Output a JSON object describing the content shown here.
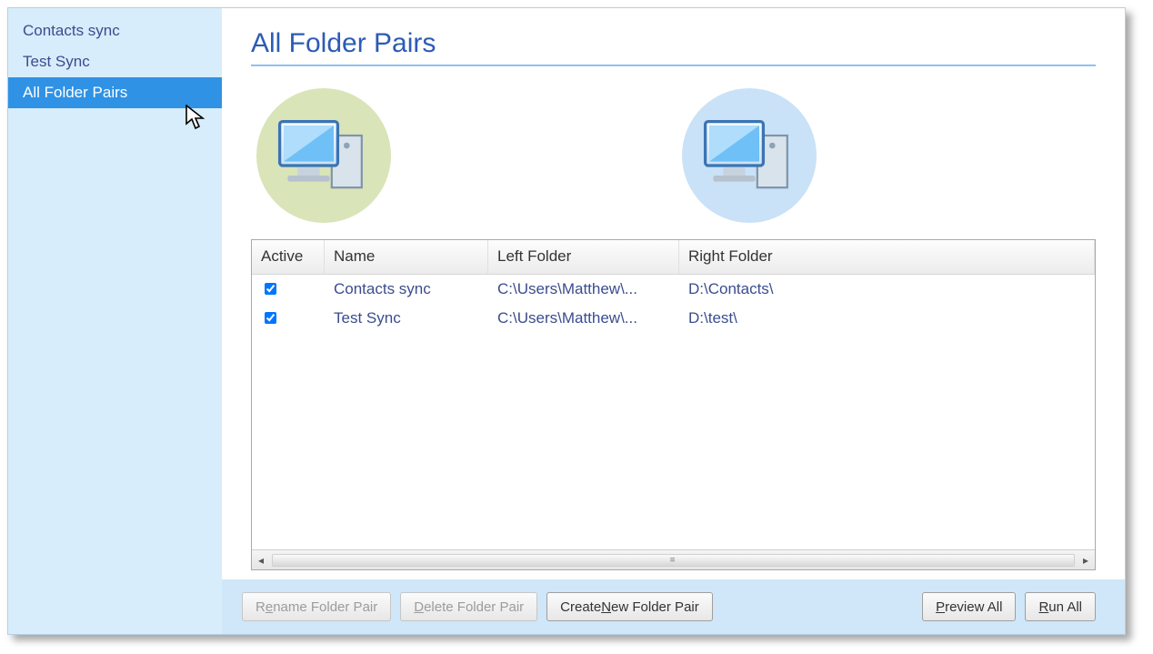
{
  "sidebar": {
    "items": [
      {
        "label": "Contacts sync",
        "selected": false
      },
      {
        "label": "Test Sync",
        "selected": false
      },
      {
        "label": "All Folder Pairs",
        "selected": true
      }
    ]
  },
  "page": {
    "title": "All Folder Pairs"
  },
  "grid": {
    "columns": {
      "active": "Active",
      "name": "Name",
      "left": "Left Folder",
      "right": "Right Folder"
    },
    "rows": [
      {
        "active": true,
        "name": "Contacts sync",
        "left": "C:\\Users\\Matthew\\...",
        "right": "D:\\Contacts\\"
      },
      {
        "active": true,
        "name": "Test Sync",
        "left": "C:\\Users\\Matthew\\...",
        "right": "D:\\test\\"
      }
    ]
  },
  "buttons": {
    "rename": {
      "pre": "R",
      "mn": "e",
      "post": "name Folder Pair"
    },
    "delete": {
      "pre": "",
      "mn": "D",
      "post": "elete Folder Pair"
    },
    "create": {
      "pre": "Create ",
      "mn": "N",
      "post": "ew Folder Pair"
    },
    "preview": {
      "pre": "",
      "mn": "P",
      "post": "review All"
    },
    "runall": {
      "pre": "",
      "mn": "R",
      "post": "un All"
    }
  },
  "icons": {
    "left_circle": "computer-left-icon",
    "right_circle": "computer-right-icon"
  }
}
